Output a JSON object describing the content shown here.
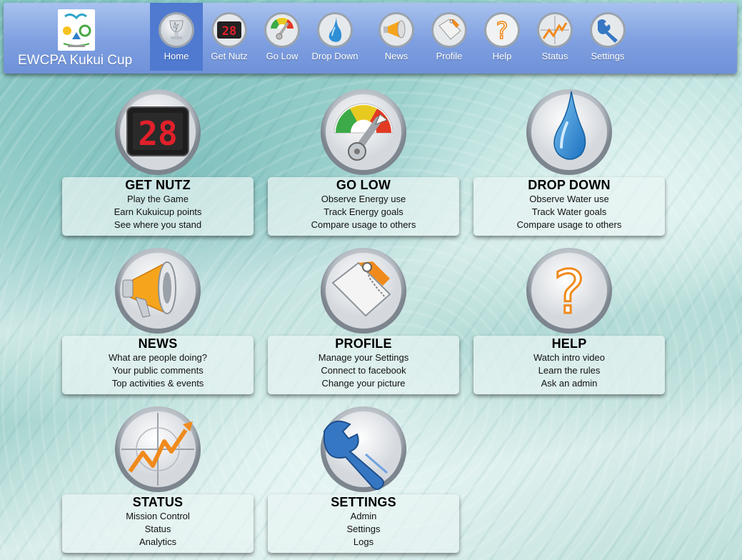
{
  "brand": {
    "title": "EWCPA Kukui Cup"
  },
  "nav": [
    {
      "label": "Home",
      "icon": "trophy-icon",
      "active": true
    },
    {
      "label": "Get Nutz",
      "icon": "scoreboard-icon"
    },
    {
      "label": "Go Low",
      "icon": "energy-gauge-icon"
    },
    {
      "label": "Drop Down",
      "icon": "water-drop-icon"
    },
    {
      "label": "News",
      "icon": "megaphone-icon"
    },
    {
      "label": "Profile",
      "icon": "profile-tag-icon"
    },
    {
      "label": "Help",
      "icon": "question-mark-icon"
    },
    {
      "label": "Status",
      "icon": "status-chart-icon"
    },
    {
      "label": "Settings",
      "icon": "wrench-icon"
    }
  ],
  "tiles": [
    {
      "title": "GET NUTZ",
      "icon": "scoreboard-icon",
      "scoreboard_value": "28",
      "lines": [
        "Play the Game",
        "Earn Kukuicup points",
        "See where you stand"
      ]
    },
    {
      "title": "GO LOW",
      "icon": "energy-gauge-icon",
      "lines": [
        "Observe Energy use",
        "Track Energy goals",
        "Compare usage to others"
      ]
    },
    {
      "title": "DROP DOWN",
      "icon": "water-drop-icon",
      "lines": [
        "Observe Water use",
        "Track Water goals",
        "Compare usage to others"
      ]
    },
    {
      "title": "NEWS",
      "icon": "megaphone-icon",
      "lines": [
        "What are people doing?",
        "Your public comments",
        "Top activities & events"
      ]
    },
    {
      "title": "PROFILE",
      "icon": "profile-tag-icon",
      "lines": [
        "Manage your Settings",
        "Connect to facebook",
        "Change your picture"
      ]
    },
    {
      "title": "HELP",
      "icon": "question-mark-icon",
      "lines": [
        "Watch intro video",
        "Learn the rules",
        "Ask an admin"
      ]
    },
    {
      "title": "STATUS",
      "icon": "status-chart-icon",
      "lines": [
        "Mission Control",
        "Status",
        "Analytics"
      ]
    },
    {
      "title": "SETTINGS",
      "icon": "wrench-icon",
      "lines": [
        "Admin",
        "Settings",
        "Logs"
      ]
    }
  ],
  "colors": {
    "navbar": "#7e9fe0",
    "nav_active": "#4f7ad0",
    "orange_accent": "#f08a1c",
    "water_blue": "#2f8fd6",
    "scoreboard_red": "#e0202a"
  }
}
